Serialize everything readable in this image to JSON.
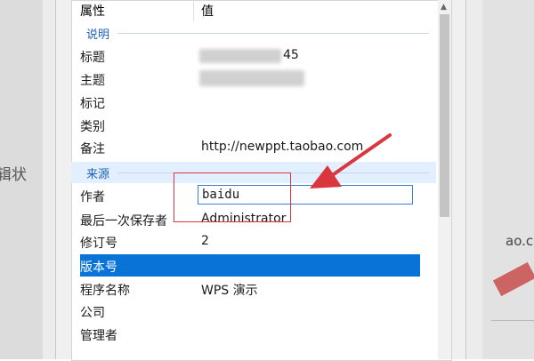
{
  "background": {
    "left_text": "辑状",
    "right_text": "ao.c"
  },
  "header": {
    "name_col": "属性",
    "value_col": "值"
  },
  "groups": {
    "description": "说明",
    "origin": "来源"
  },
  "description_rows": [
    {
      "name": "标题",
      "value": "45"
    },
    {
      "name": "主题",
      "value": ""
    },
    {
      "name": "标记",
      "value": ""
    },
    {
      "name": "类别",
      "value": ""
    },
    {
      "name": "备注",
      "value": "http://newppt.taobao.com"
    }
  ],
  "origin_rows": [
    {
      "name": "作者",
      "value": "baidu"
    },
    {
      "name": "最后一次保存者",
      "value": "Administrator"
    },
    {
      "name": "修订号",
      "value": "2"
    },
    {
      "name": "版本号",
      "value": ""
    },
    {
      "name": "程序名称",
      "value": "WPS 演示"
    },
    {
      "name": "公司",
      "value": ""
    },
    {
      "name": "管理者",
      "value": ""
    }
  ],
  "colors": {
    "selection": "#0a73d8",
    "callout": "#d9363e",
    "group_text": "#1e63b5"
  }
}
